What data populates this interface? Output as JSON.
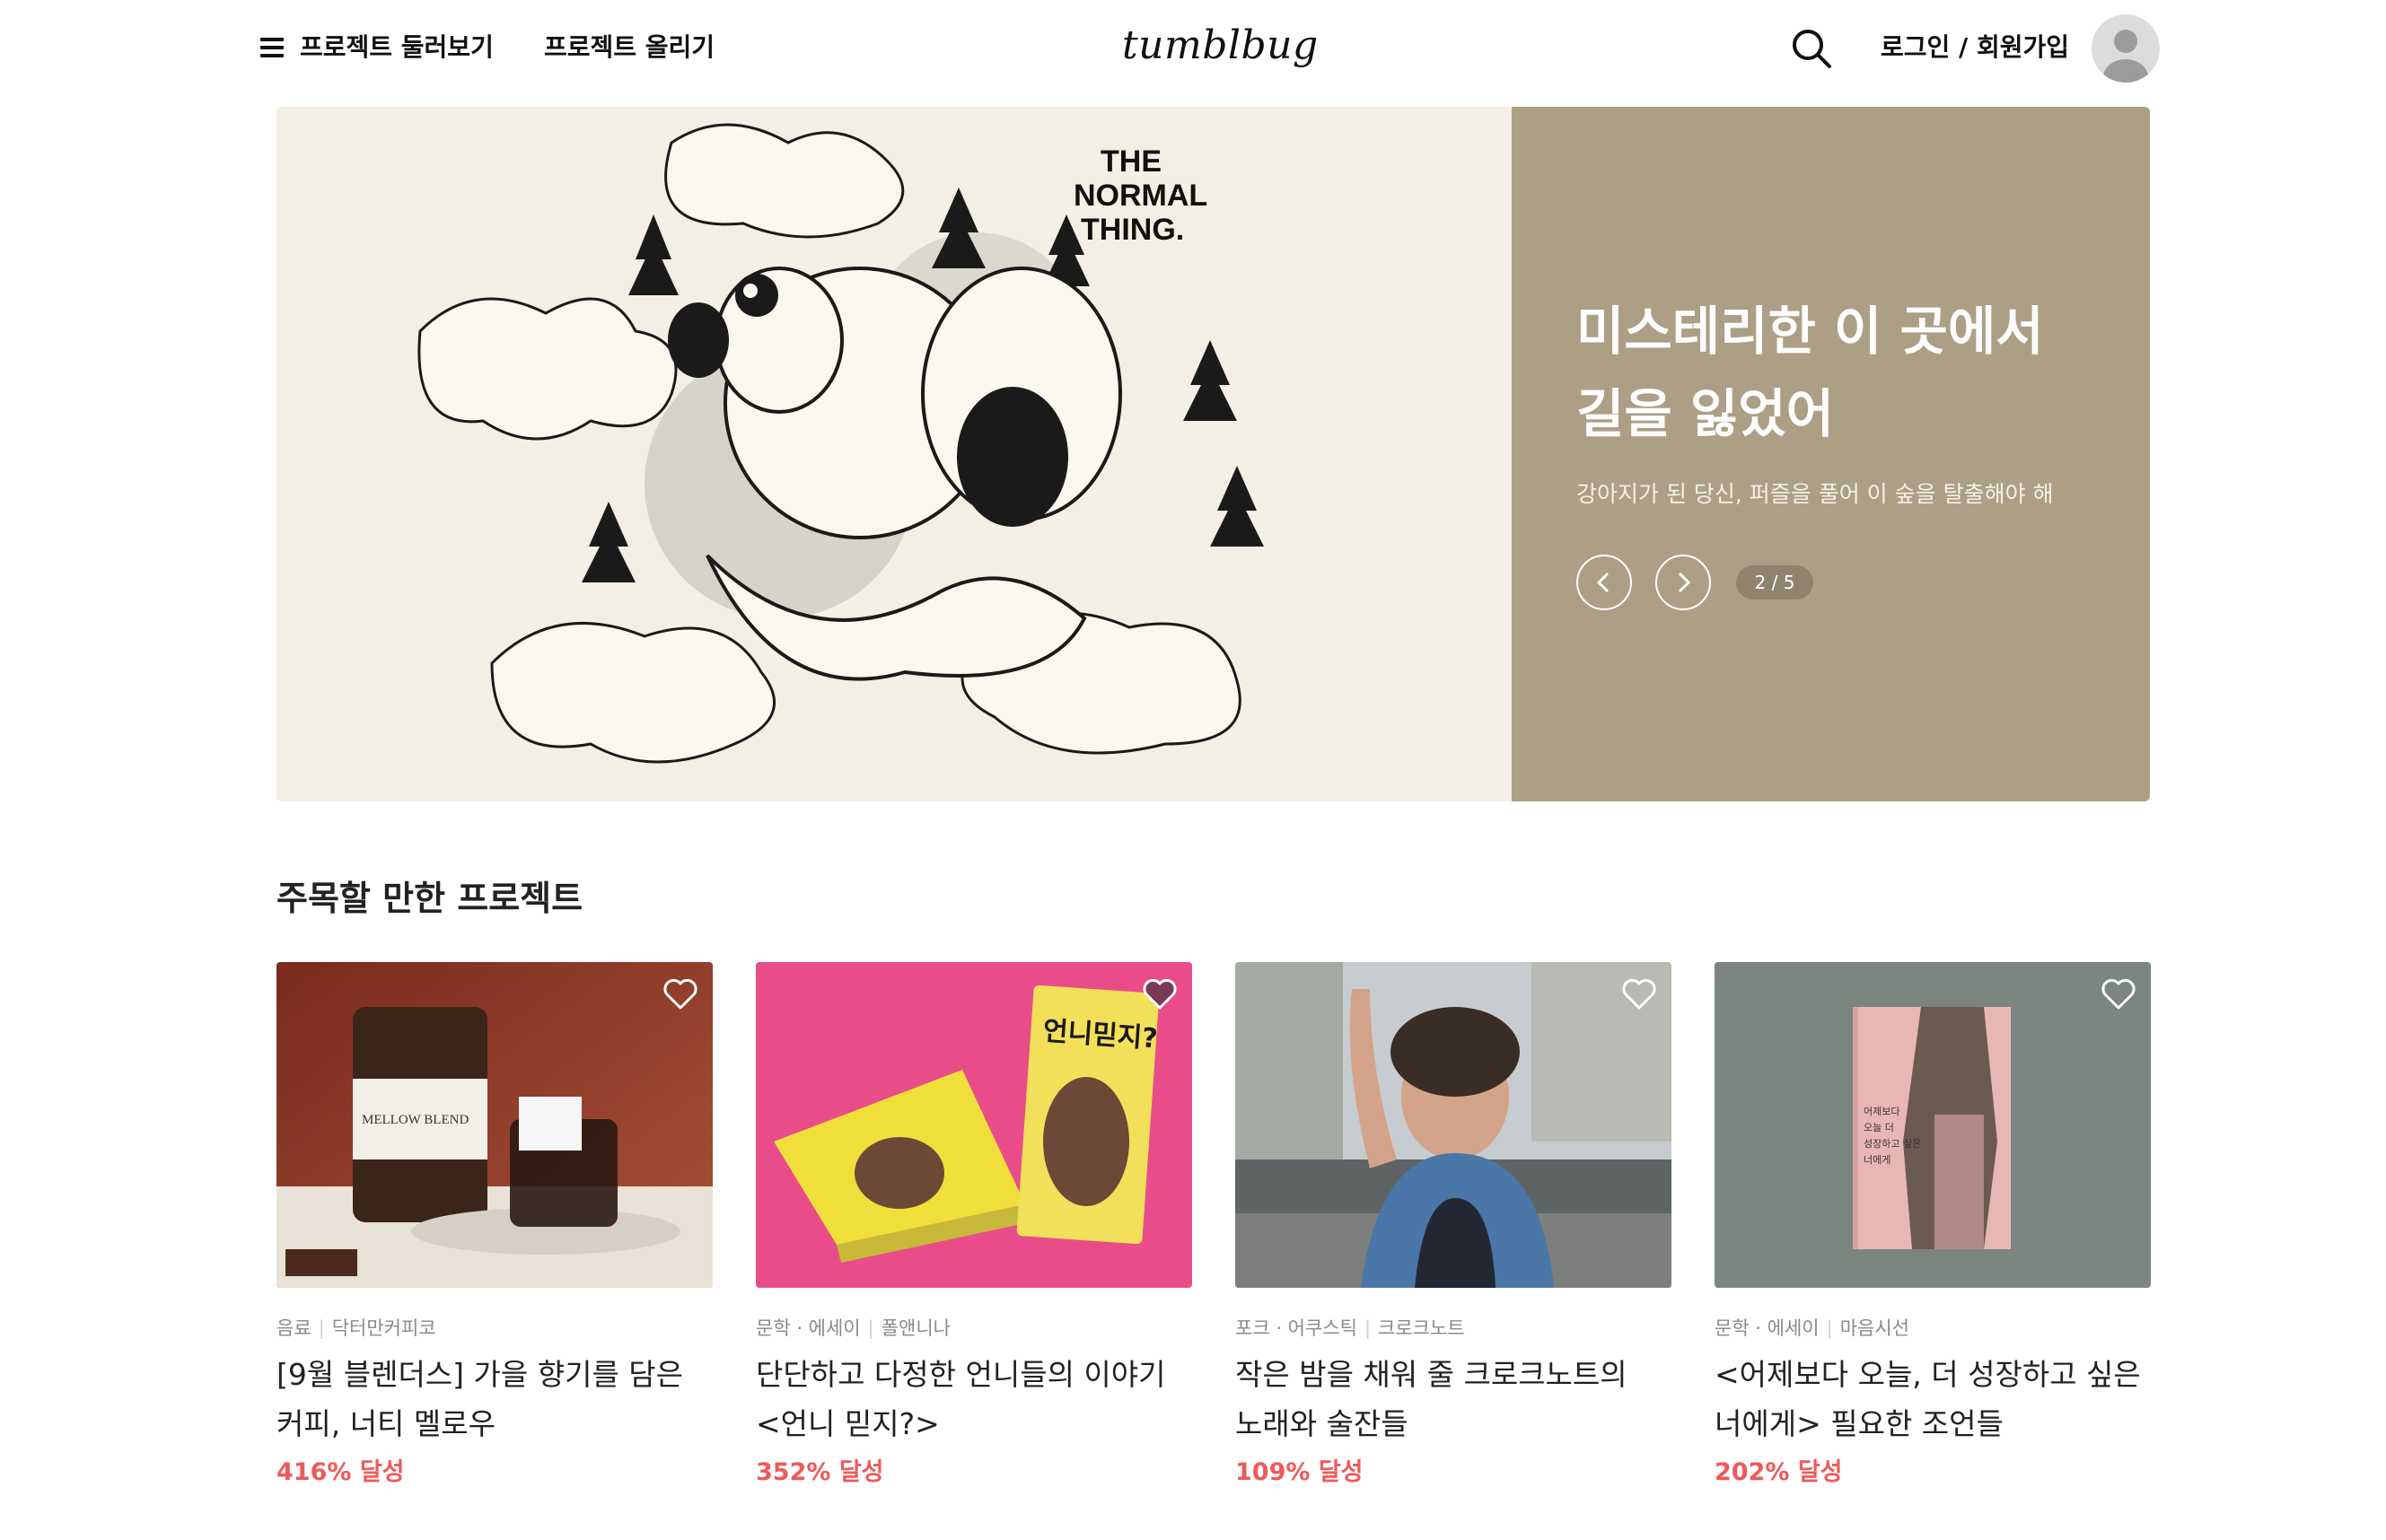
{
  "header": {
    "nav_browse": "프로젝트 둘러보기",
    "nav_upload": "프로젝트 올리기",
    "logo": "tumblbug",
    "login": "로그인 / 회원가입"
  },
  "hero": {
    "art_text": "THE NORMAL THING.",
    "title_line1": "미스테리한 이 곳에서",
    "title_line2": "길을 잃었어",
    "subtitle": "강아지가 된 당신, 퍼즐을 풀어 이 숲을 탈출해야 해",
    "counter": "2 / 5",
    "panel_color": "#ac9f85"
  },
  "featured": {
    "title": "주목할 만한 프로젝트",
    "cards": [
      {
        "category": "음료",
        "creator": "닥터만커피코",
        "title_line1": "[9월 블렌더스] 가을 향기를 담은",
        "title_line2": "커피, 너티 멜로우",
        "achievement": "416% 달성",
        "art_text": "MELLOW BLEND",
        "liked": false
      },
      {
        "category": "문학 · 에세이",
        "creator": "폴앤니나",
        "title_line1": "단단하고 다정한 언니들의 이야기",
        "title_line2": "<언니 믿지?>",
        "achievement": "352% 달성",
        "art_text": "언니믿지?",
        "liked": true
      },
      {
        "category": "포크 · 어쿠스틱",
        "creator": "크로크노트",
        "title_line1": "작은 밤을 채워 줄 크로크노트의",
        "title_line2": "노래와 술잔들",
        "achievement": "109% 달성",
        "liked": false
      },
      {
        "category": "문학 · 에세이",
        "creator": "마음시선",
        "title_line1": "<어제보다 오늘, 더 성장하고 싶은",
        "title_line2": "너에게> 필요한 조언들",
        "achievement": "202% 달성",
        "art_text": "어제보다 오늘 더 성장하고 싶은 너에게",
        "liked": false
      }
    ]
  },
  "colors": {
    "accent_red": "#ee5a5a",
    "hero_panel": "#ac9f85",
    "card2_bg": "#e94d89",
    "card4_bg": "#7c857f"
  }
}
